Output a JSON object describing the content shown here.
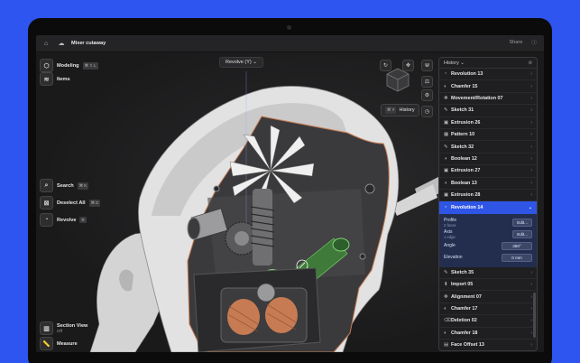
{
  "app": {
    "document_title": "Mixer cutaway",
    "share_label": "Share"
  },
  "toolbar": {
    "modeling_label": "Modeling",
    "modeling_keys": "⌘ ⇧ L",
    "items_label": "Items"
  },
  "viewport": {
    "revolve_dropdown": "Revolve (Y) ⌄"
  },
  "tools": [
    {
      "label": "Search",
      "key": "⌘ K"
    },
    {
      "label": "Deselect All",
      "key": "⌘ D"
    },
    {
      "label": "Revolve",
      "key": "R"
    }
  ],
  "bottom_tools": {
    "section_view_label": "Section View",
    "section_view_state": "Off",
    "measure_label": "Measure"
  },
  "history_pill": {
    "label": "History",
    "keys": "⌘ Y"
  },
  "history": {
    "title": "History ⌄",
    "items_before": [
      {
        "label": "Revolution 13",
        "icon": "◔"
      },
      {
        "label": "Chamfer 15",
        "icon": "◐"
      },
      {
        "label": "Movement/Rotation 07",
        "icon": "✥"
      },
      {
        "label": "Sketch 31",
        "icon": "✎"
      },
      {
        "label": "Extrusion 26",
        "icon": "▣"
      },
      {
        "label": "Pattern 10",
        "icon": "▦"
      },
      {
        "label": "Sketch 32",
        "icon": "✎"
      },
      {
        "label": "Boolean 12",
        "icon": "◑"
      },
      {
        "label": "Extrusion 27",
        "icon": "▣"
      },
      {
        "label": "Boolean 13",
        "icon": "◑"
      },
      {
        "label": "Extrusion 28",
        "icon": "▣"
      }
    ],
    "selected": {
      "label": "Revolution 14",
      "icon": "◔"
    },
    "detail": {
      "profile_label": "Profile",
      "profile_sub": "2 faces",
      "profile_button": "Edit...",
      "axis_label": "Axis",
      "axis_sub": "1 edge",
      "axis_button": "Edit...",
      "angle_label": "Angle",
      "angle_value": "360°",
      "elevation_label": "Elevation",
      "elevation_value": "0 mm"
    },
    "items_after": [
      {
        "label": "Sketch 35",
        "icon": "✎"
      },
      {
        "label": "Import 05",
        "icon": "⬇"
      },
      {
        "label": "Alignment 07",
        "icon": "✥"
      },
      {
        "label": "Chamfer 17",
        "icon": "◐"
      },
      {
        "label": "Deletion 02",
        "icon": "⌫"
      },
      {
        "label": "Chamfer 18",
        "icon": "◐"
      },
      {
        "label": "Face Offset 13",
        "icon": "▤"
      }
    ]
  },
  "colors": {
    "background": "#2f55f0",
    "selection": "#2f55e6",
    "highlight_part": "#3f7a3a",
    "coil": "#c77b52"
  }
}
